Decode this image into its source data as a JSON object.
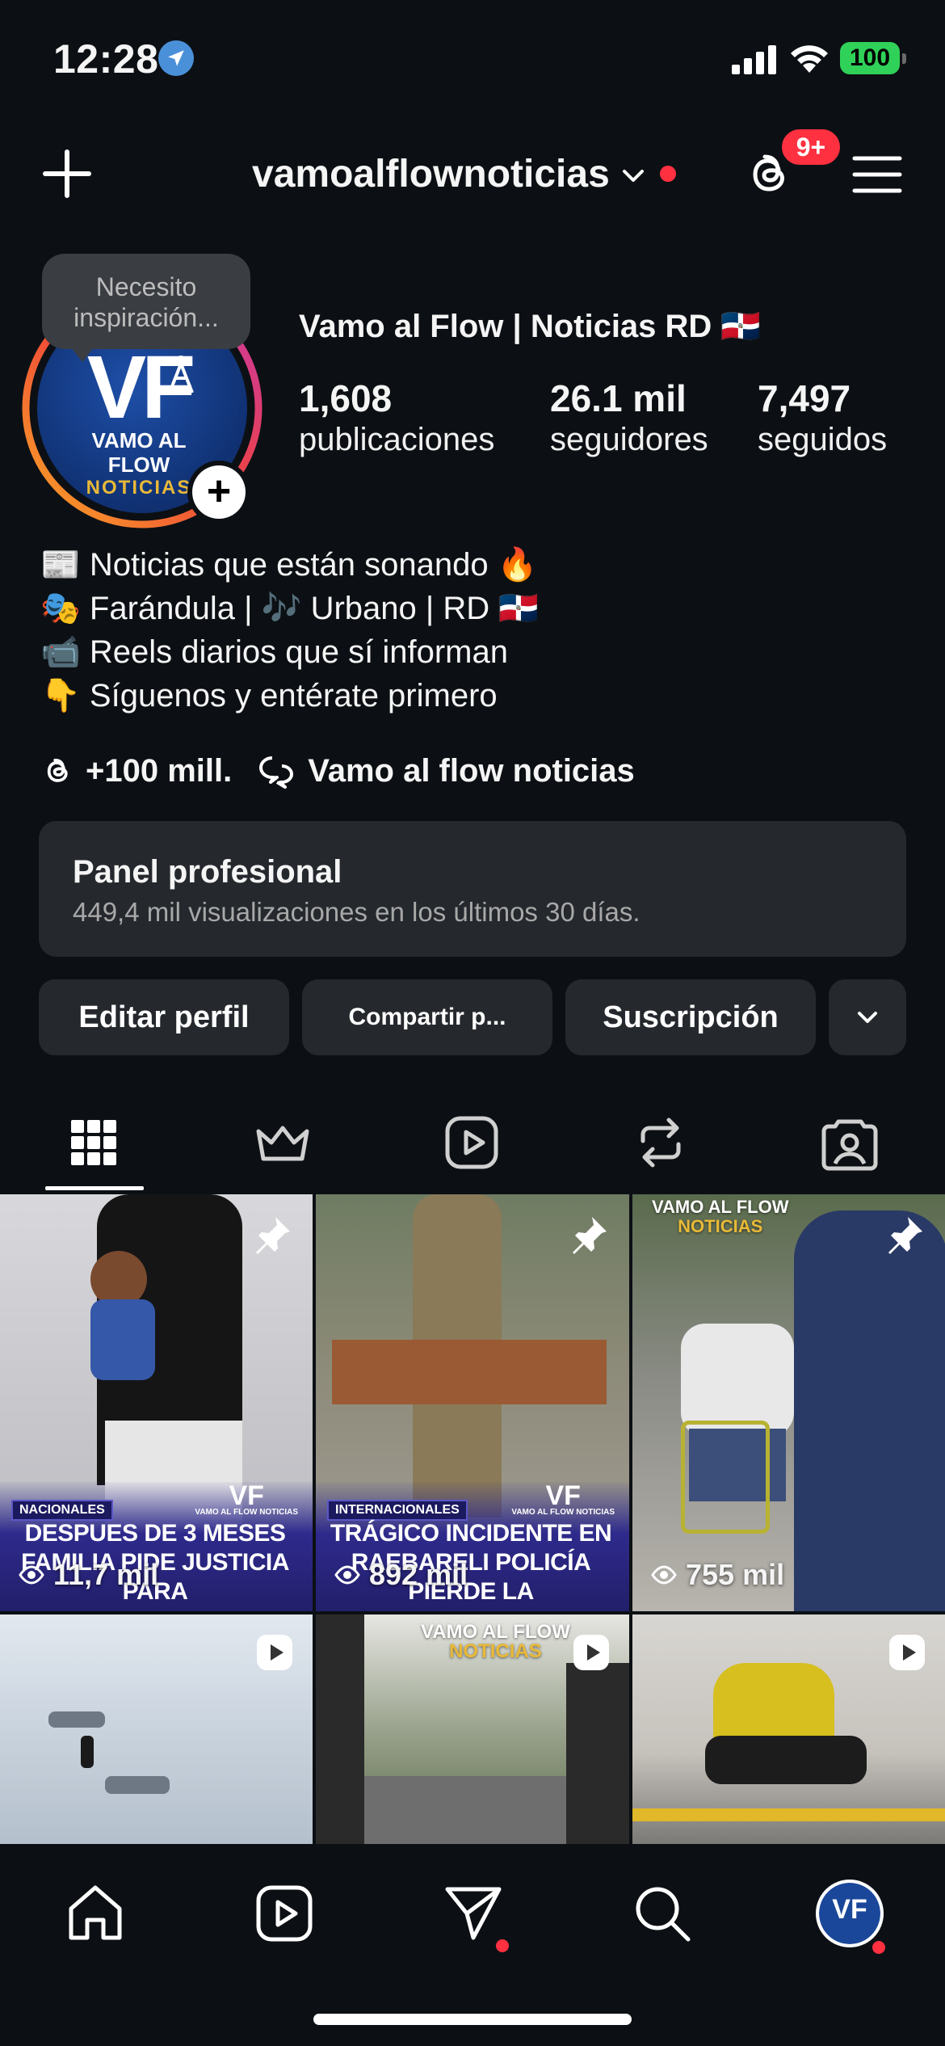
{
  "status_bar": {
    "time": "12:28",
    "battery": "100"
  },
  "header": {
    "username": "vamoalflownoticias",
    "threads_badge": "9+"
  },
  "profile": {
    "tooltip": "Necesito inspiración...",
    "avatar_text": {
      "line1": "VF",
      "line2": "VAMO AL FLOW",
      "line3": "NOTICIAS"
    },
    "full_name": "Vamo al Flow | Noticias RD 🇩🇴",
    "stats": [
      {
        "value": "1,608",
        "label": "publicaciones"
      },
      {
        "value": "26.1 mil",
        "label": "seguidores"
      },
      {
        "value": "7,497",
        "label": "seguidos"
      }
    ],
    "bio": [
      "📰 Noticias que están sonando 🔥",
      "🎭 Farándula | 🎶 Urbano | RD 🇩🇴",
      "📹 Reels diarios que sí informan",
      "👇 Síguenos y entérate primero"
    ],
    "threads_link": "+100 mill.",
    "channel_link": "Vamo al flow noticias"
  },
  "panel": {
    "title": "Panel profesional",
    "subtitle": "449,4 mil visualizaciones en los últimos 30 días."
  },
  "buttons": {
    "edit": "Editar perfil",
    "share": "Compartir p...",
    "subscription": "Suscripción"
  },
  "grid": [
    {
      "views": "11,7 mil",
      "category": "NACIONALES",
      "headline": "Despues de 3 meses familia pide justicia para",
      "pinned": true,
      "brand": "VF",
      "brand_sub": "VAMO AL FLOW NOTICIAS"
    },
    {
      "views": "892 mil",
      "category": "INTERNACIONALES",
      "headline": "Trágico incidente en Raebareli policía pierde la",
      "pinned": true,
      "brand": "VF",
      "brand_sub": "VAMO AL FLOW NOTICIAS"
    },
    {
      "views": "755 mil",
      "watermark_top": "VAMO AL FLOW",
      "watermark_bottom": "NOTICIAS",
      "pinned": true
    },
    {
      "reel": true
    },
    {
      "reel": true,
      "watermark_top": "VAMO AL FLOW",
      "watermark_bottom": "NOTICIAS"
    },
    {
      "reel": true
    }
  ],
  "colors": {
    "background": "#0c1014",
    "surface": "#25292e",
    "notification": "#ff3040",
    "battery": "#30d158"
  }
}
